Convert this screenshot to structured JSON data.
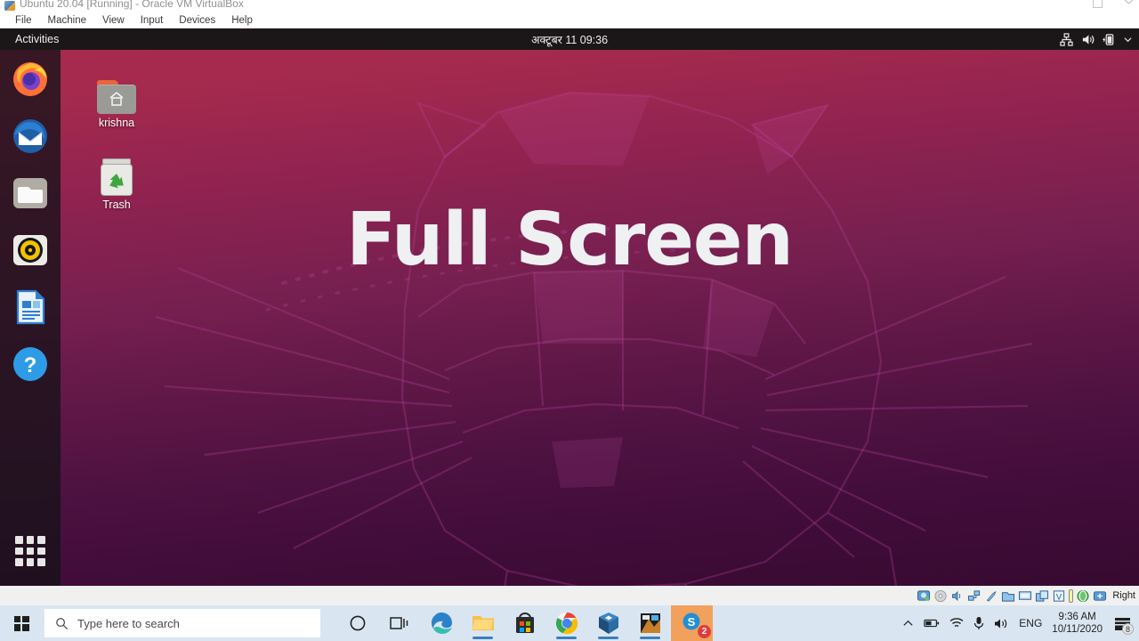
{
  "vbox": {
    "title": "Ubuntu 20.04 [Running] - Oracle VM VirtualBox",
    "menu": [
      "File",
      "Machine",
      "View",
      "Input",
      "Devices",
      "Help"
    ],
    "window_controls": [
      "minimize",
      "restore",
      "close"
    ],
    "statusbar": {
      "devices": [
        "hard-disk",
        "optical-disk",
        "audio",
        "network",
        "usb",
        "shared-folder",
        "display",
        "recording",
        "virtualization",
        "mouse-integration",
        "keyboard"
      ],
      "host_key": "Right"
    }
  },
  "ubuntu": {
    "topbar": {
      "activities": "Activities",
      "clock": "अक्टूबर 11  09:36",
      "tray": [
        "network-icon",
        "volume-icon",
        "battery-icon",
        "chevron-down-icon"
      ]
    },
    "desktop_icons": [
      {
        "label": "krishna",
        "icon": "home-folder-icon"
      },
      {
        "label": "Trash",
        "icon": "trash-icon"
      }
    ],
    "dock": [
      {
        "name": "firefox",
        "label": "Firefox"
      },
      {
        "name": "thunderbird",
        "label": "Thunderbird Mail"
      },
      {
        "name": "files",
        "label": "Files"
      },
      {
        "name": "rhythmbox",
        "label": "Rhythmbox"
      },
      {
        "name": "libreoffice-writer",
        "label": "LibreOffice Writer"
      },
      {
        "name": "help",
        "label": "Help"
      }
    ],
    "show_apps_label": "Show Applications",
    "overlay_text": "Full Screen",
    "wallpaper_colors": {
      "top": "#a82b4f",
      "bottom": "#370a31"
    }
  },
  "windows": {
    "start_label": "Start",
    "search_placeholder": "Type here to search",
    "taskbar_items": [
      {
        "name": "cortana",
        "label": "Cortana",
        "active": false,
        "running": false
      },
      {
        "name": "task-view",
        "label": "Task View",
        "active": false,
        "running": false
      },
      {
        "name": "edge",
        "label": "Microsoft Edge",
        "active": false,
        "running": false
      },
      {
        "name": "file-explorer",
        "label": "File Explorer",
        "active": false,
        "running": true
      },
      {
        "name": "microsoft-store",
        "label": "Microsoft Store",
        "active": false,
        "running": false
      },
      {
        "name": "chrome",
        "label": "Google Chrome",
        "active": false,
        "running": true
      },
      {
        "name": "virtualbox",
        "label": "Oracle VM VirtualBox",
        "active": false,
        "running": true
      },
      {
        "name": "editor",
        "label": "Editor",
        "active": false,
        "running": true
      },
      {
        "name": "snagit",
        "label": "Snagit",
        "active": true,
        "running": true,
        "badge": "2"
      }
    ],
    "tray": {
      "icons": [
        "chevron-up-icon",
        "battery-icon",
        "wifi-icon",
        "microphone-icon",
        "volume-icon"
      ],
      "language": "ENG",
      "time": "9:36 AM",
      "date": "10/11/2020",
      "notification_count": "8"
    }
  }
}
